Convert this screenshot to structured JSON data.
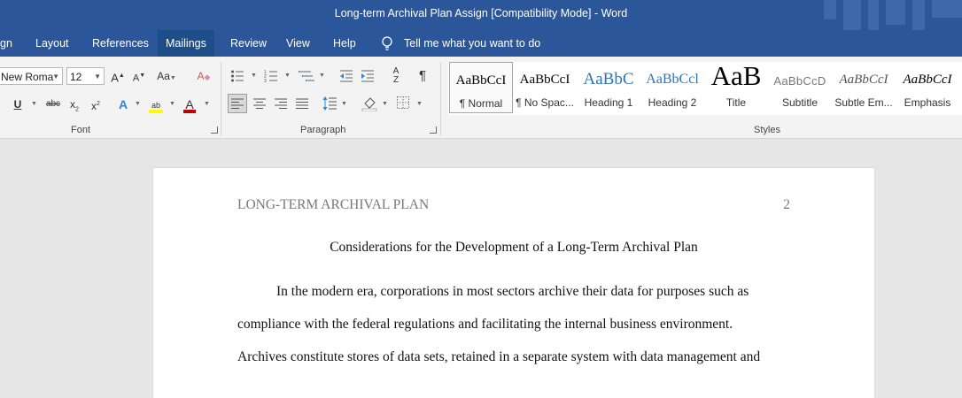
{
  "window": {
    "title": "Long-term Archival Plan Assign [Compatibility Mode]  -  Word"
  },
  "menu": {
    "items": [
      "gn",
      "Layout",
      "References",
      "Mailings",
      "Review",
      "View",
      "Help"
    ],
    "active": "Mailings",
    "tell_me": "Tell me what you want to do"
  },
  "font": {
    "name": "New Roma",
    "size": "12",
    "group_label": "Font"
  },
  "paragraph": {
    "group_label": "Paragraph"
  },
  "styles": {
    "group_label": "Styles",
    "items": [
      {
        "preview": "AaBbCcI",
        "name": "¶ Normal"
      },
      {
        "preview": "AaBbCcI",
        "name": "¶ No Spac..."
      },
      {
        "preview": "AaBbC",
        "name": "Heading 1"
      },
      {
        "preview": "AaBbCcl",
        "name": "Heading 2"
      },
      {
        "preview": "AaB",
        "name": "Title"
      },
      {
        "preview": "AaBbCcD",
        "name": "Subtitle"
      },
      {
        "preview": "AaBbCcI",
        "name": "Subtle Em..."
      },
      {
        "preview": "AaBbCcI",
        "name": "Emphasis"
      }
    ]
  },
  "document": {
    "header": "LONG-TERM ARCHIVAL PLAN",
    "page_number": "2",
    "title": "Considerations for the Development of a Long-Term Archival Plan",
    "lines": [
      "In the modern era, corporations in most sectors archive their data for purposes such as",
      "compliance with the federal regulations and facilitating the internal business environment.",
      "Archives constitute stores of data sets, retained in a separate system with data management and"
    ]
  },
  "colors": {
    "accent": "#2b579a",
    "highlight": "#ffff00",
    "font_color": "#c00000"
  }
}
